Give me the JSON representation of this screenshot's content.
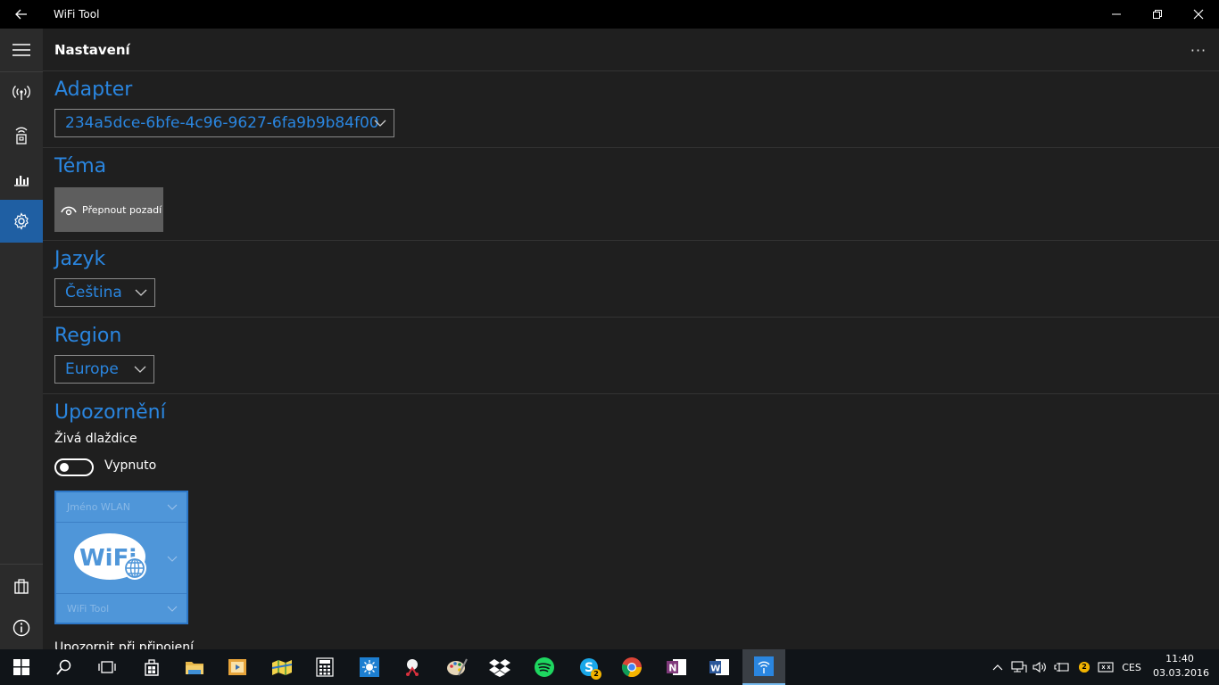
{
  "window": {
    "title": "WiFi Tool"
  },
  "header": {
    "title": "Nastavení",
    "more": "···"
  },
  "adapter": {
    "title": "Adapter",
    "value": "234a5dce-6bfe-4c96-9627-6fa9b9b84f00"
  },
  "theme": {
    "title": "Téma",
    "button": "Přepnout pozadí"
  },
  "language": {
    "title": "Jazyk",
    "value": "Čeština"
  },
  "region": {
    "title": "Region",
    "value": "Europe"
  },
  "notifications": {
    "title": "Upozornění",
    "live_tile_label": "Živá dlaždice",
    "toggle_state": "Vypnuto",
    "tile_top": "Jméno WLAN",
    "tile_bottom": "WiFi Tool",
    "tile_logo": "WiFi",
    "next_label": "Upozornit při připojení"
  },
  "tray": {
    "lang": "CES",
    "time": "11:40",
    "date": "03.03.2016",
    "skype_badge": "2",
    "tray_badge": "2"
  },
  "colors": {
    "accent": "#2a86e0",
    "active_nav": "#1f5fa3",
    "tile": "#4f96d9"
  }
}
